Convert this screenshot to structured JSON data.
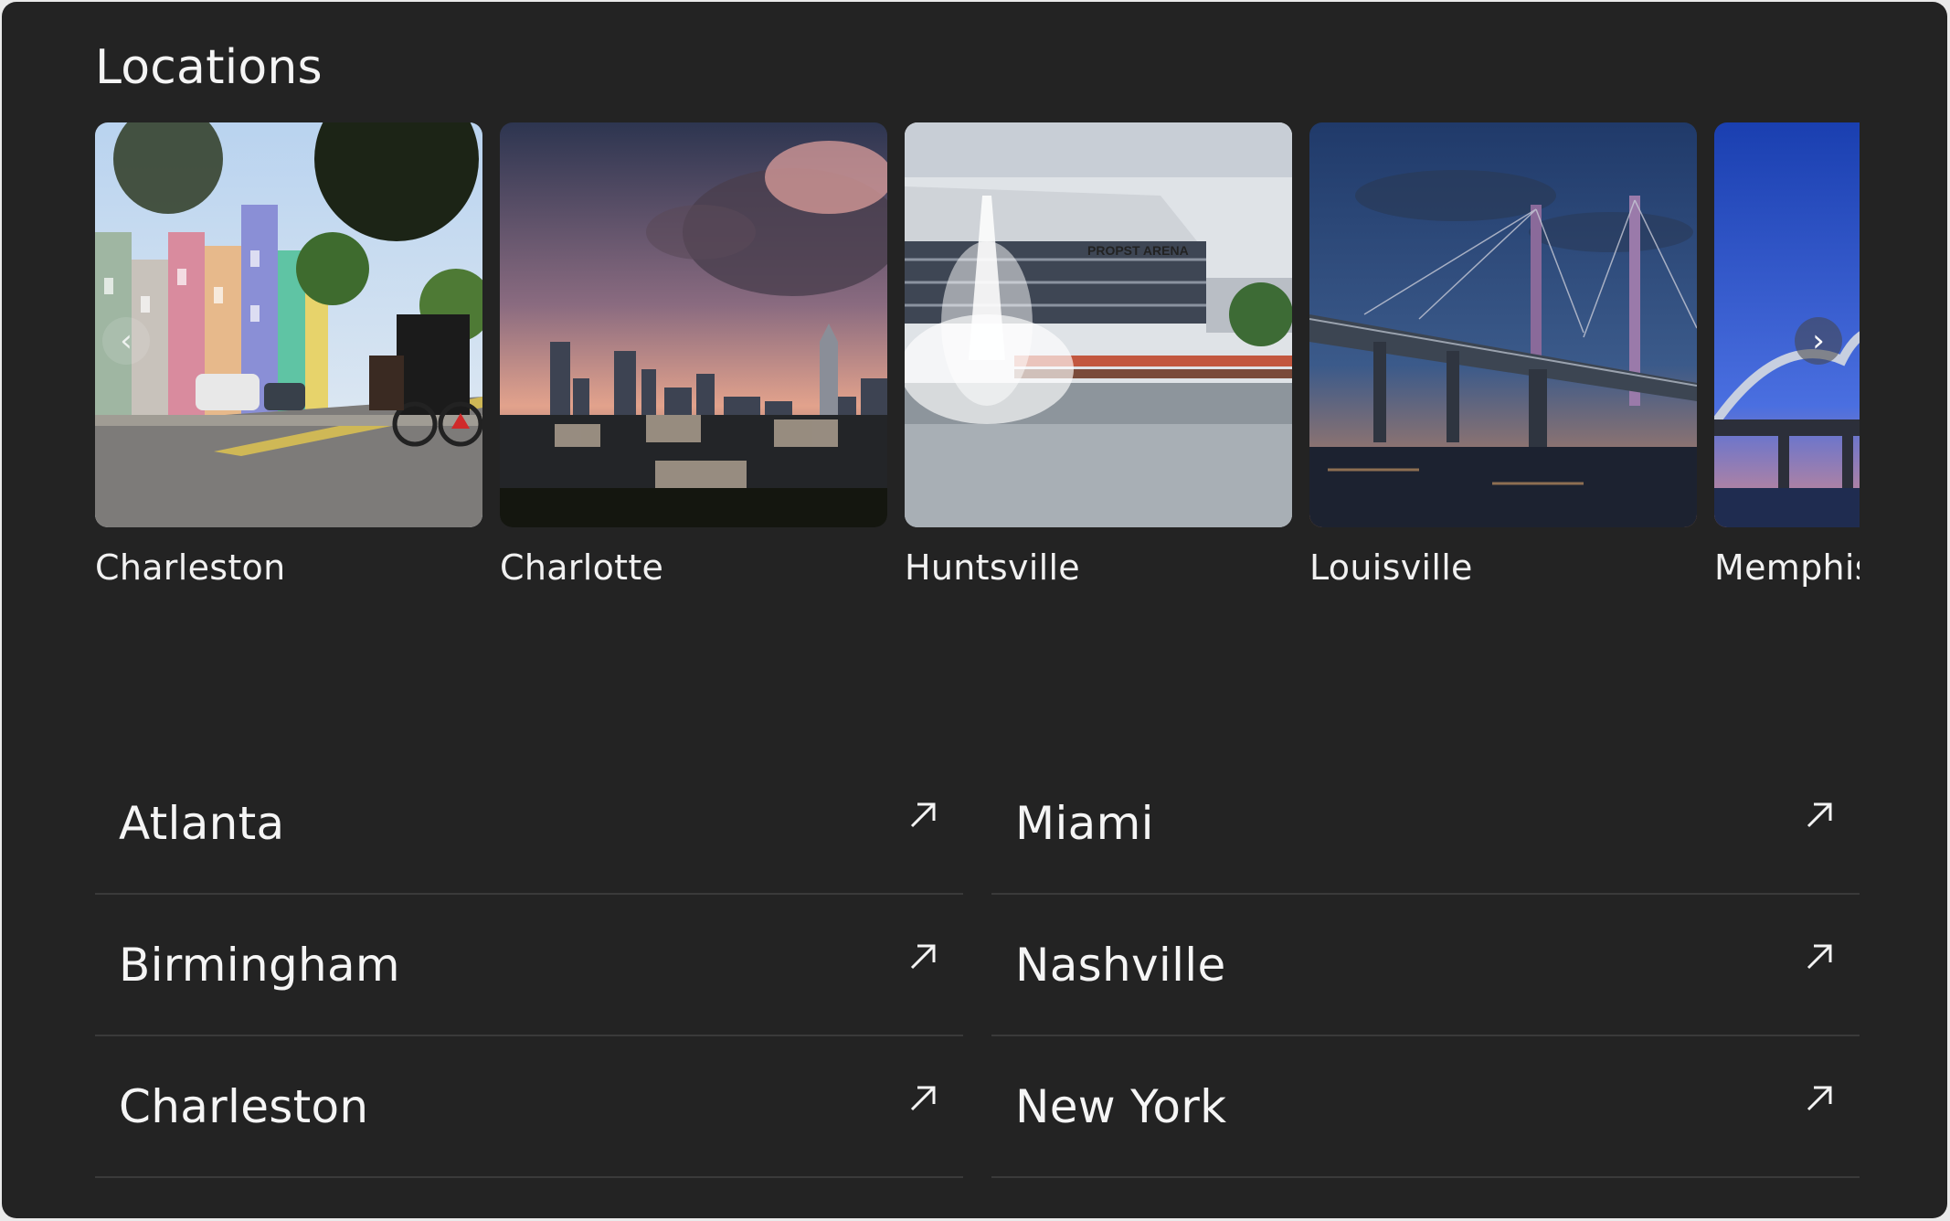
{
  "title": "Locations",
  "carousel": {
    "cards": [
      {
        "label": "Charleston",
        "icon": "street-photo"
      },
      {
        "label": "Charlotte",
        "icon": "skyline-photo"
      },
      {
        "label": "Huntsville",
        "icon": "fountain-photo"
      },
      {
        "label": "Louisville",
        "icon": "bridge-photo"
      },
      {
        "label": "Memphis",
        "icon": "arch-bridge-photo"
      }
    ],
    "arena_sign": "PROPST ARENA",
    "prev_icon": "‹",
    "next_icon": "›"
  },
  "list": {
    "left": [
      {
        "label": "Atlanta"
      },
      {
        "label": "Birmingham"
      },
      {
        "label": "Charleston"
      }
    ],
    "right": [
      {
        "label": "Miami"
      },
      {
        "label": "Nashville"
      },
      {
        "label": "New York"
      }
    ],
    "icon": "external-link-arrow-icon"
  },
  "colors": {
    "background": "#232323",
    "text": "#f4f4f4",
    "divider": "#3a3a3a"
  }
}
